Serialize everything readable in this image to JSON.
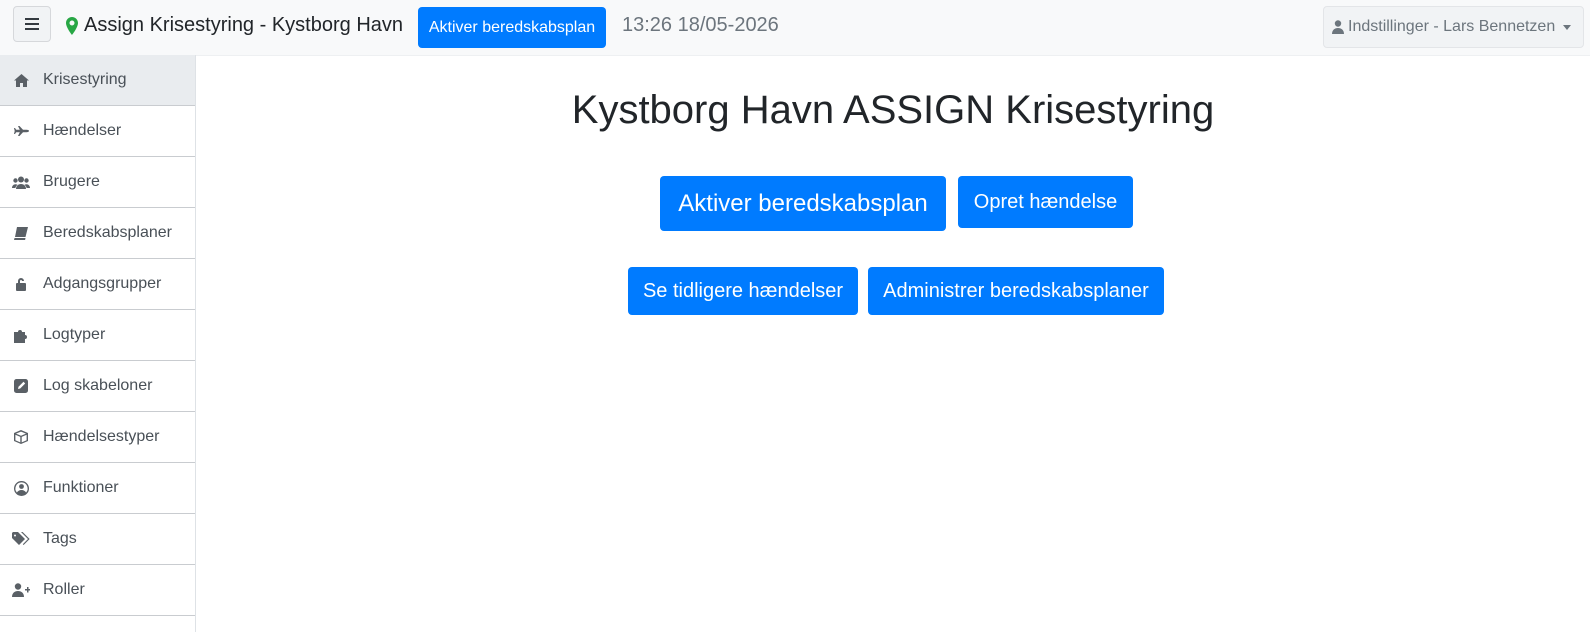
{
  "topbar": {
    "title": "Assign Krisestyring - Kystborg Havn",
    "activate_label": "Aktiver beredskabsplan",
    "datetime": "13:26 18/05-2026",
    "user_menu_label": "Indstillinger - Lars Bennetzen"
  },
  "sidebar": {
    "items": [
      {
        "label": "Krisestyring",
        "icon": "home-icon"
      },
      {
        "label": "Hændelser",
        "icon": "plane-icon"
      },
      {
        "label": "Brugere",
        "icon": "users-icon"
      },
      {
        "label": "Beredskabsplaner",
        "icon": "book-icon"
      },
      {
        "label": "Adgangsgrupper",
        "icon": "unlock-icon"
      },
      {
        "label": "Logtyper",
        "icon": "puzzle-icon"
      },
      {
        "label": "Log skabeloner",
        "icon": "edit-icon"
      },
      {
        "label": "Hændelsestyper",
        "icon": "cube-icon"
      },
      {
        "label": "Funktioner",
        "icon": "user-circle-icon"
      },
      {
        "label": "Tags",
        "icon": "tags-icon"
      },
      {
        "label": "Roller",
        "icon": "user-plus-icon"
      }
    ]
  },
  "main": {
    "title": "Kystborg Havn ASSIGN Krisestyring",
    "activate_label": "Aktiver beredskabsplan",
    "create_event_label": "Opret hændelse",
    "previous_events_label": "Se tidligere hændelser",
    "manage_plans_label": "Administrer beredskabsplaner"
  },
  "colors": {
    "primary": "#007bff",
    "marker": "#28a745",
    "topbar_bg": "#f8f9fa",
    "active_item_bg": "#e9ecef"
  }
}
